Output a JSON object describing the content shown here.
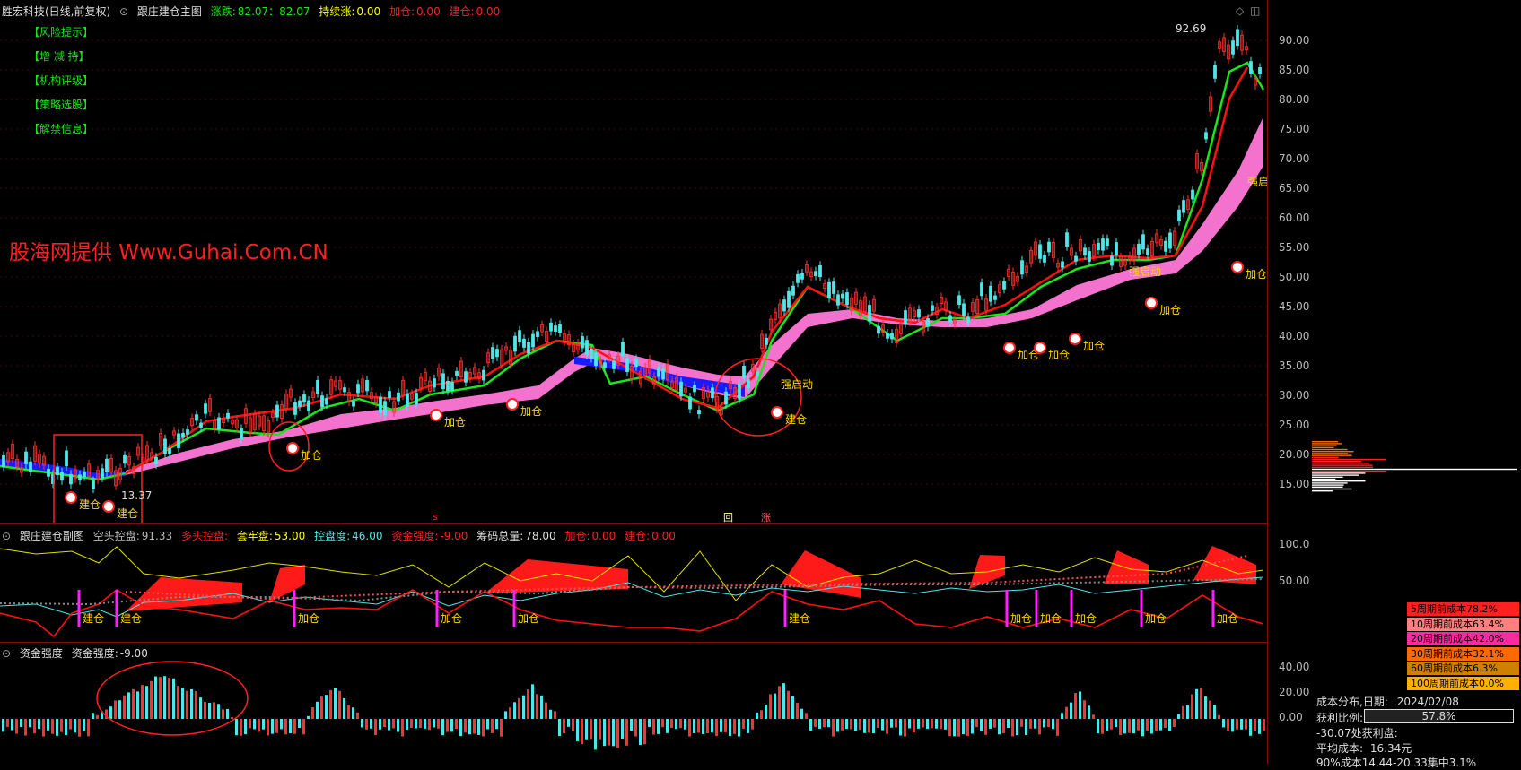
{
  "header": {
    "stock_title": "胜宏科技(日线,前复权)",
    "main_chart_name": "跟庄建仓主图",
    "zhangdie_label": "涨跌:",
    "zhangdie_value": "82.07：82.07",
    "chixu_label": "持续涨:",
    "chixu_value": "0.00",
    "jiacang_label": "加仓:",
    "jiacang_value": "0.00",
    "jiancang_label": "建仓:",
    "jiancang_value": "0.00"
  },
  "side_menu": [
    "【风险提示】",
    "【增 减 持】",
    "【机构评级】",
    "【策略选股】",
    "【解禁信息】"
  ],
  "watermark": "股海网提供 Www.Guhai.Com.CN",
  "main_axis": [
    "90.00",
    "85.00",
    "80.00",
    "75.00",
    "70.00",
    "65.00",
    "60.00",
    "55.00",
    "50.00",
    "45.00",
    "40.00",
    "35.00",
    "30.00",
    "25.00",
    "20.00",
    "15.00"
  ],
  "price_annotations": {
    "high": "92.69",
    "low": "13.37",
    "signals": [
      "建仓",
      "建仓",
      "加仓",
      "加仓",
      "加仓",
      "建仓",
      "强启动",
      "加仓",
      "加仓",
      "加仓",
      "强启动",
      "加仓",
      "加仓",
      "强启动"
    ]
  },
  "sub_chart": {
    "name": "跟庄建仓副图",
    "kongtou_label": "空头控盘:",
    "kongtou_value": "91.33",
    "duotou_label": "多头控盘:",
    "taolao_label": "套牢盘:",
    "taolao_value": "53.00",
    "kongpan_label": "控盘度:",
    "kongpan_value": "46.00",
    "zijin_label": "资金强度:",
    "zijin_value": "-9.00",
    "chouma_label": "筹码总量:",
    "chouma_value": "78.00",
    "jiacang_label": "加仓:",
    "jiacang_value": "0.00",
    "jiancang_label": "建仓:",
    "jiancang_value": "0.00",
    "axis": [
      "100.0",
      "50.00"
    ]
  },
  "flow_chart": {
    "name": "资金强度",
    "label": "资金强度:",
    "value": "-9.00",
    "axis": [
      "40.00",
      "20.00",
      "0.00"
    ]
  },
  "cost_legend": [
    {
      "label": "5周期前成本78.2%",
      "color": "#ff2020"
    },
    {
      "label": "10周期前成本63.4%",
      "color": "#ff8080"
    },
    {
      "label": "20周期前成本42.0%",
      "color": "#ff2aa0"
    },
    {
      "label": "30周期前成本32.1%",
      "color": "#ff6a00"
    },
    {
      "label": "60周期前成本6.3%",
      "color": "#d08000"
    },
    {
      "label": "100周期前成本0.0%",
      "color": "#ffb000"
    }
  ],
  "cost_info": {
    "date_label": "成本分布,日期:",
    "date_value": "2024/02/08",
    "profit_label": "获利比例:",
    "profit_value": "57.8%",
    "profit_fraction": 0.578,
    "line2": "-30.07处获利盘:",
    "avg_label": "平均成本:",
    "avg_value": "16.34元",
    "line4": "90%成本14.44-20.33集中3.1%"
  },
  "markers": {
    "hui": "回",
    "zhang": "涨",
    "s": "s"
  },
  "colors": {
    "accent_red": "#ff2020",
    "green": "#18e818",
    "yellow": "#ffff00",
    "cyan": "#4ee6e6",
    "pink": "#ff78d8",
    "blue": "#1a1aff"
  }
}
